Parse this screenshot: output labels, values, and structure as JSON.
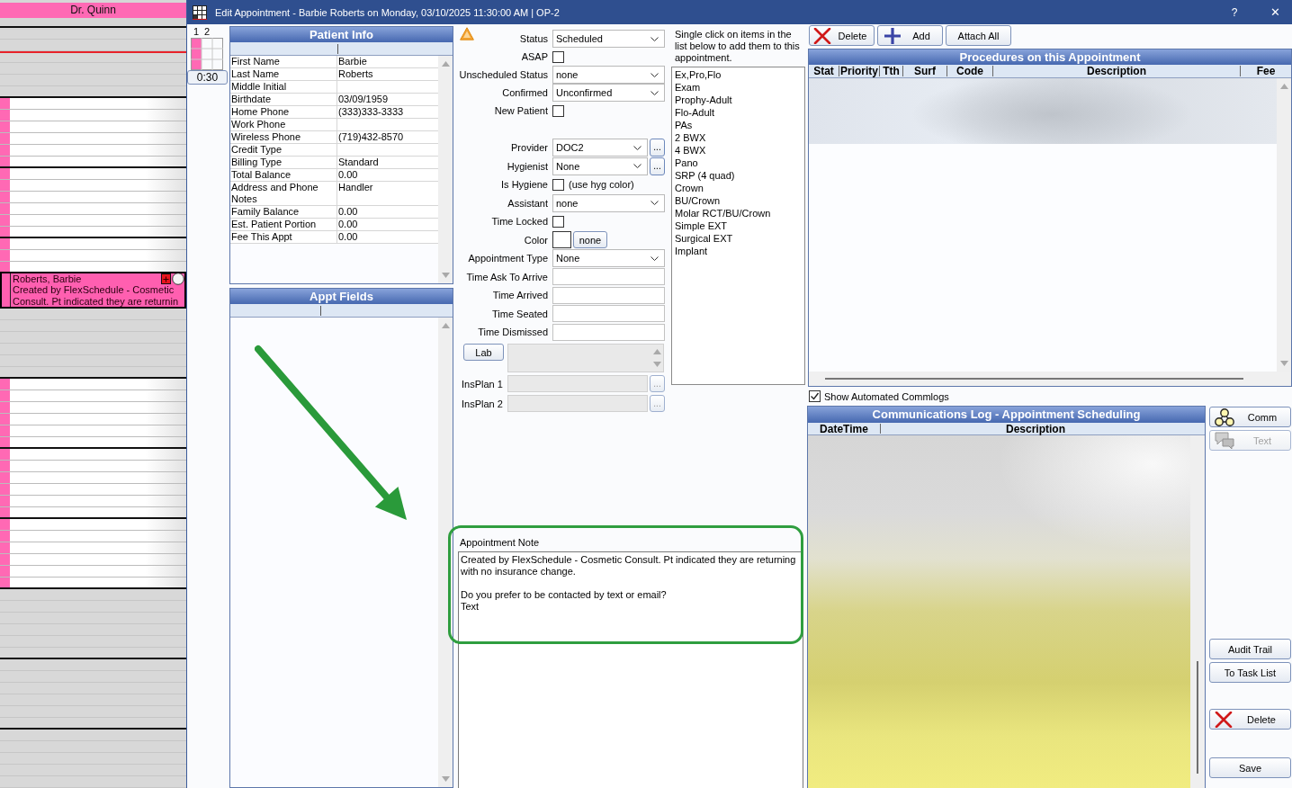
{
  "schedule": {
    "provider": "Dr. Quinn",
    "blocks": [
      {
        "open": false,
        "now": true
      },
      {
        "open": true,
        "now": false
      },
      {
        "open": true,
        "now": false
      },
      {
        "open": true,
        "now": false,
        "appointment": {
          "patient": "Roberts, Barbie",
          "note_lines": [
            "Created by FlexSchedule - Cosmetic",
            "Consult. Pt indicated they are returnin"
          ]
        }
      },
      {
        "open": false,
        "now": false
      },
      {
        "open": true,
        "now": false
      },
      {
        "open": true,
        "now": false
      },
      {
        "open": true,
        "now": false
      },
      {
        "open": false,
        "now": false
      },
      {
        "open": false,
        "now": false
      },
      {
        "open": false,
        "now": false
      }
    ]
  },
  "window": {
    "title": "Edit Appointment - Barbie Roberts on Monday, 03/10/2025 11:30:00 AM | OP-2",
    "help": "?",
    "close": "✕"
  },
  "time_bar": {
    "columns": [
      "1",
      "2"
    ],
    "length": "0:30"
  },
  "patient_info": {
    "title": "Patient Info",
    "rows": [
      {
        "label": "First Name",
        "value": "Barbie"
      },
      {
        "label": "Last Name",
        "value": "Roberts"
      },
      {
        "label": "Middle Initial"
      },
      {
        "label": "Birthdate",
        "value": "03/09/1959"
      },
      {
        "label": "Home Phone",
        "value": "(333)333-3333"
      },
      {
        "label": "Work Phone"
      },
      {
        "label": "Wireless Phone",
        "value": "(719)432-8570"
      },
      {
        "label": "Credit Type"
      },
      {
        "label": "Billing Type",
        "value": "Standard"
      },
      {
        "label": "Total Balance",
        "value": "0.00"
      },
      {
        "label": "Address and Phone Notes",
        "value": "Handler"
      },
      {
        "label": "Family Balance",
        "value": "0.00"
      },
      {
        "label": "Est. Patient Portion",
        "value": "0.00"
      },
      {
        "label": "Fee This Appt",
        "value": "0.00"
      }
    ]
  },
  "appt_fields": {
    "title": "Appt Fields"
  },
  "form": {
    "warning": true,
    "groups": [
      {
        "fields": [
          {
            "kind": "select",
            "label": "Status",
            "value": "Scheduled"
          },
          {
            "kind": "check",
            "label": "ASAP",
            "checked": false
          },
          {
            "kind": "select",
            "label": "Unscheduled Status",
            "value": "none"
          },
          {
            "kind": "select",
            "label": "Confirmed",
            "value": "Unconfirmed"
          },
          {
            "kind": "check",
            "label": "New Patient",
            "checked": false
          }
        ]
      },
      {
        "fields": [
          {
            "kind": "picker",
            "label": "Provider",
            "value": "DOC2",
            "button": "..."
          },
          {
            "kind": "picker",
            "label": "Hygienist",
            "value": "None",
            "button": "..."
          },
          {
            "kind": "check",
            "label": "Is Hygiene",
            "checked": false,
            "note": "(use hyg color)"
          },
          {
            "kind": "select",
            "label": "Assistant",
            "value": "none"
          },
          {
            "kind": "check",
            "label": "Time Locked",
            "checked": false
          },
          {
            "kind": "color",
            "label": "Color",
            "button": "none"
          },
          {
            "kind": "select",
            "label": "Appointment Type",
            "value": "None"
          },
          {
            "kind": "text",
            "label": "Time Ask To Arrive"
          },
          {
            "kind": "text",
            "label": "Time Arrived"
          },
          {
            "kind": "text",
            "label": "Time Seated"
          },
          {
            "kind": "text",
            "label": "Time Dismissed"
          }
        ]
      }
    ],
    "attachments": [
      {
        "kind": "lab",
        "button": "Lab",
        "disabled": true
      },
      {
        "kind": "plan",
        "label": "InsPlan 1",
        "button": "...",
        "disabled": true
      },
      {
        "kind": "plan",
        "label": "InsPlan 2",
        "button": "...",
        "disabled": true
      }
    ]
  },
  "quick_add": {
    "instruction": "Single click on items in the list below to add them to this appointment.",
    "items": [
      "Ex,Pro,Flo",
      "Exam",
      "Prophy-Adult",
      "Flo-Adult",
      "PAs",
      "2 BWX",
      "4 BWX",
      "Pano",
      "SRP (4 quad)",
      "Crown",
      "BU/Crown",
      "Molar RCT/BU/Crown",
      "Simple EXT",
      "Surgical EXT",
      "Implant"
    ]
  },
  "note": {
    "label": "Appointment Note",
    "text": "Created by FlexSchedule - Cosmetic Consult. Pt indicated they are returning with no insurance change.\n\nDo you prefer to be contacted by text or email?\nText"
  },
  "procedures": {
    "buttons": [
      {
        "kind": "delete",
        "label": "Delete"
      },
      {
        "kind": "add",
        "label": "Add"
      },
      {
        "kind": "attach",
        "label": "Attach All"
      }
    ],
    "title": "Procedures on this Appointment",
    "columns": [
      "Stat",
      "Priority",
      "Tth",
      "Surf",
      "Code",
      "Description",
      "Fee"
    ],
    "redacted": true
  },
  "commlog": {
    "show_automated": {
      "label": "Show Automated Commlogs",
      "checked": true
    },
    "title": "Communications Log - Appointment Scheduling",
    "columns": [
      "DateTime",
      "Description"
    ],
    "redacted": true
  },
  "side_buttons": [
    {
      "kind": "comm",
      "label": "Comm",
      "disabled": false
    },
    {
      "kind": "text",
      "label": "Text",
      "disabled": true
    },
    {
      "kind": "audit",
      "label": "Audit Trail",
      "disabled": false
    },
    {
      "kind": "task",
      "label": "To Task List",
      "disabled": false
    },
    {
      "kind": "delete",
      "label": "Delete",
      "disabled": false
    },
    {
      "kind": "save",
      "label": "Save",
      "disabled": false
    }
  ],
  "markup": {
    "arrow": true,
    "frame": true
  }
}
